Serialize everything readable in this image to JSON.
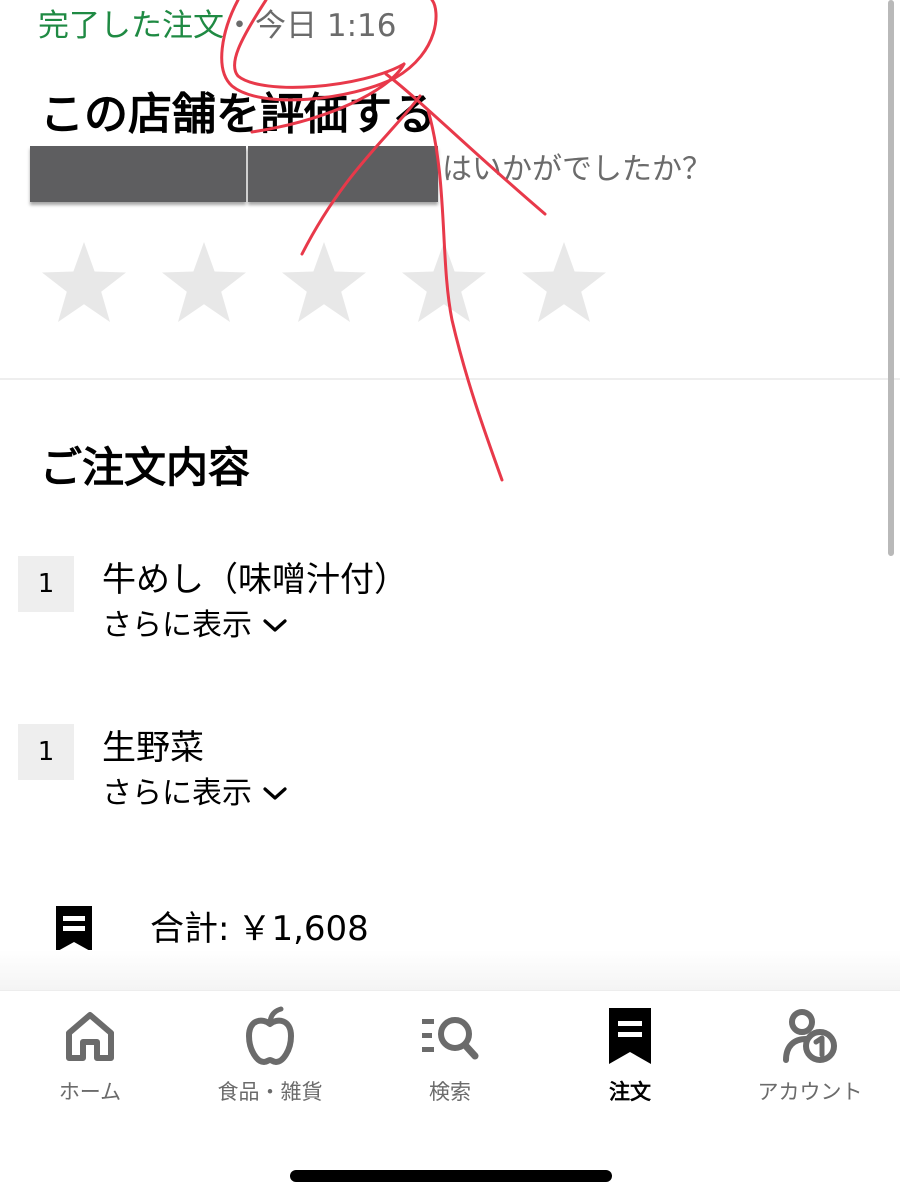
{
  "status": {
    "completed": "完了した注文",
    "separator": "・",
    "time": "今日 1:16"
  },
  "rating": {
    "title": "この店舗を評価する",
    "question_suffix": "はいかがでしたか？",
    "stars": [
      0,
      0,
      0,
      0,
      0
    ],
    "star_color": "#e8e8e8"
  },
  "order": {
    "title": "ご注文内容",
    "items": [
      {
        "qty": "1",
        "name": "牛めし（味噌汁付）",
        "more_label": "さらに表示"
      },
      {
        "qty": "1",
        "name": "生野菜",
        "more_label": "さらに表示"
      }
    ],
    "total_label": "合計:",
    "total_value": "￥1,608"
  },
  "nav": {
    "items": [
      {
        "label": "ホーム",
        "icon": "home-icon"
      },
      {
        "label": "食品・雑貨",
        "icon": "apple-icon"
      },
      {
        "label": "検索",
        "icon": "search-icon"
      },
      {
        "label": "注文",
        "icon": "orders-icon",
        "active": true
      },
      {
        "label": "アカウント",
        "icon": "account-icon"
      }
    ]
  },
  "colors": {
    "completed_green": "#1f8a43",
    "annotation_red": "#e8394a",
    "redaction_gray": "#5e5e60"
  }
}
